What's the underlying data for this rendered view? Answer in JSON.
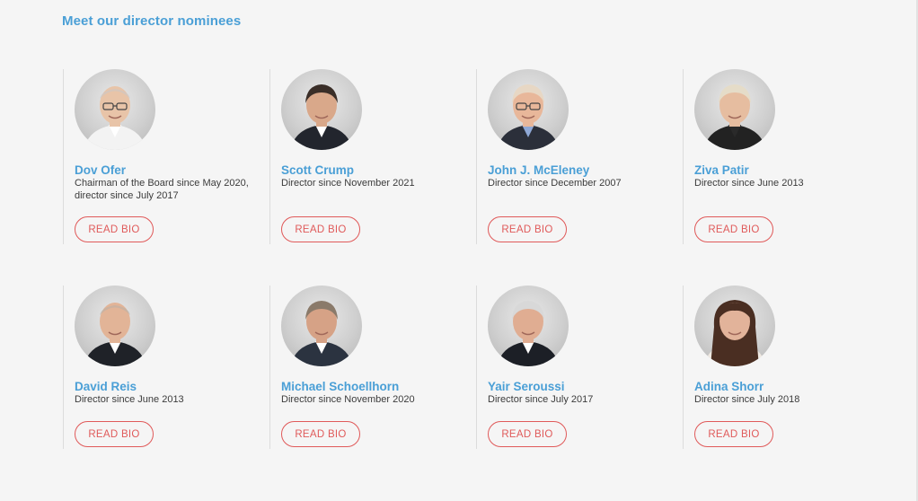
{
  "section": {
    "title": "Meet our director nominees"
  },
  "button_label": "READ BIO",
  "colors": {
    "accent_blue": "#4a9fd6",
    "button_red": "#e05a5a",
    "background": "#f5f5f5"
  },
  "directors": [
    {
      "name": "Dov Ofer",
      "role": "Chairman of the Board since May 2020, director since July 2017",
      "hair": "#c9c9c9",
      "skin": "#e8c4a8",
      "suit": "#f3f3f3",
      "shirt": "#ffffff",
      "hair_style": "bald",
      "glasses": true
    },
    {
      "name": "Scott Crump",
      "role": "Director since November 2021",
      "hair": "#3a2e28",
      "skin": "#d9a88a",
      "suit": "#22252d",
      "shirt": "#ffffff",
      "hair_style": "short",
      "glasses": false
    },
    {
      "name": "John J. McEleney",
      "role": "Director since December 2007",
      "hair": "#e7d7c4",
      "skin": "#e8b79a",
      "suit": "#2b2f3a",
      "shirt": "#8fa8d6",
      "hair_style": "short",
      "glasses": true
    },
    {
      "name": "Ziva Patir",
      "role": "Director since June 2013",
      "hair": "#e5dcc8",
      "skin": "#e6bda0",
      "suit": "#222222",
      "shirt": "#2a2a2a",
      "hair_style": "short",
      "glasses": false
    },
    {
      "name": "David Reis",
      "role": "Director since June 2013",
      "hair": "#b8b0a8",
      "skin": "#e2b497",
      "suit": "#1f2228",
      "shirt": "#ffffff",
      "hair_style": "bald",
      "glasses": false
    },
    {
      "name": "Michael Schoellhorn",
      "role": "Director since November 2020",
      "hair": "#8a7a6a",
      "skin": "#d6a286",
      "suit": "#2b3340",
      "shirt": "#ffffff",
      "hair_style": "short",
      "glasses": false
    },
    {
      "name": "Yair Seroussi",
      "role": "Director since July 2017",
      "hair": "#d8d8d8",
      "skin": "#e0ad92",
      "suit": "#1c1f26",
      "shirt": "#ffffff",
      "hair_style": "short",
      "glasses": false
    },
    {
      "name": "Adina Shorr",
      "role": "Director since July 2018",
      "hair": "#4a2e22",
      "skin": "#e2b39a",
      "suit": "#efe9e2",
      "shirt": "#efe9e2",
      "hair_style": "long",
      "glasses": false
    }
  ]
}
